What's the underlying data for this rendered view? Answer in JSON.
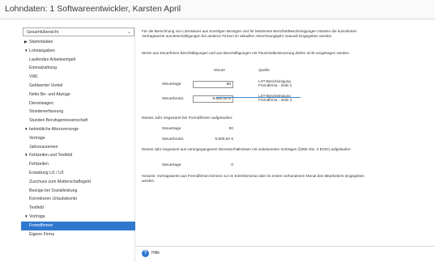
{
  "window": {
    "title": "Lohndaten: 1  Softwareentwickler, Karsten  April"
  },
  "sidebar": {
    "dropdown": "Gesamtübersicht",
    "items": [
      {
        "label": "Stammdaten",
        "level": 0,
        "arrow": "▶"
      },
      {
        "label": "Lohnangaben",
        "level": 0,
        "arrow": "▼"
      },
      {
        "label": "Laufendes Arbeitsentgelt",
        "level": 1
      },
      {
        "label": "Einmalzahlung",
        "level": 1
      },
      {
        "label": "VWL",
        "level": 1
      },
      {
        "label": "Geldwerter Vorteil",
        "level": 1
      },
      {
        "label": "Netto Be- und Abzüge",
        "level": 1
      },
      {
        "label": "Dienstwagen",
        "level": 1
      },
      {
        "label": "Stundenerfassung",
        "level": 1
      },
      {
        "label": "Stunden Berufsgenossenschaft",
        "level": 1
      },
      {
        "label": "betriebliche Altersvorsorge",
        "level": 0,
        "arrow": "▼"
      },
      {
        "label": "Verträge",
        "level": 1
      },
      {
        "label": "Jahressummen",
        "level": 1
      },
      {
        "label": "Fehlzeiten und Textfeld",
        "level": 0,
        "arrow": "▼"
      },
      {
        "label": "Fehlzeiten",
        "level": 1
      },
      {
        "label": "Erstattung U1 / U2",
        "level": 1
      },
      {
        "label": "Zuschuss zum Mutterschaftsgeld",
        "level": 1
      },
      {
        "label": "Bezüge bei Sozialleistung",
        "level": 1
      },
      {
        "label": "Korrekturen Urlaubskonto",
        "level": 1
      },
      {
        "label": "Textfeld",
        "level": 1
      },
      {
        "label": "Vorträge",
        "level": 0,
        "arrow": "▼"
      },
      {
        "label": "Fremdfirmen",
        "level": 1,
        "active": true
      },
      {
        "label": "Eigene Firma",
        "level": 1
      }
    ]
  },
  "main": {
    "intro": "Für die Berechnung von Lohnsteuer aus Sonstigen Bezügen und für bestimmte Berichte/Bescheinigungen müssen die kumulierten Vortragswerte aus Beschäftigungen bei anderen Firmen im aktuellen Abrechnungsjahr manuell eingegeben werden.",
    "note": "Werte aus steuerfreien Beschäftigungen und aus Beschäftigungen mit Pauschalbesteuerung dürfen nicht vorgetragen werden.",
    "col_steuer": "Steuer",
    "col_quelle": "Quelle",
    "steuertage_label": "Steuertage",
    "steuertage_value": "90",
    "steuertage_src1": "LST-Bescheinigung",
    "steuertage_src2": "Fremdfirma - Zeile 1",
    "steuerbrutto_label": "Steuerbrutto",
    "steuerbrutto_value": "9.500,00 €",
    "steuerbrutto_src1": "LST-Bescheinigung",
    "steuerbrutto_src2": "Fremdfirma - Zeile 3",
    "fremd_heading": "Dieses Jahr insgesamt bei Fremdfirmen aufgelaufen:",
    "fremd_tage_label": "Steuertage",
    "fremd_tage_value": "90",
    "fremd_brutto_label": "Steuerbrutto",
    "fremd_brutto_value": "9.500,00 €",
    "vorher_heading": "Dieses Jahr insgesamt aus vorangegangenen Dienstverhältnissen mit unbekannten Vorträgen (§39b Abs. 3 EStG) aufgelaufen:",
    "vorher_tage_label": "Steuertage",
    "vorher_tage_value": "0",
    "hint": "Hinweis: Vortragswerte aus Fremdfirmen können nur im Eintrittsmonat oder im ersten vorhandenen Monat des Mitarbeiters eingegeben werden."
  },
  "footer": {
    "help_label": "Hilfe"
  },
  "colors": {
    "accent": "#2f78d0",
    "divider": "#3a87c9"
  }
}
